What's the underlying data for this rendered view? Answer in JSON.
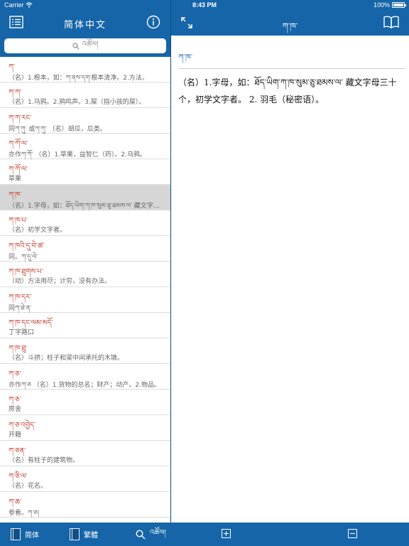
{
  "status_bar": {
    "carrier": "Carrier",
    "time": "8:43 PM",
    "battery": "100%"
  },
  "left_nav": {
    "title": "简体中文"
  },
  "right_nav": {
    "title": "ཀ་ཁ་"
  },
  "search": {
    "placeholder": "འཚོལ།"
  },
  "entries": [
    {
      "head": "ཀ་",
      "def": "（名）1.根本，如：ཀ་ནས་དག་根本清净。2.方法。"
    },
    {
      "head": "ཀ་ཀ་",
      "def": "（名）1.乌鸦。2.鸦鸣声。3.屎（指小孩的屎）。"
    },
    {
      "head": "ཀ་ཀ་རང་",
      "def": "同ཀ་ཀུ་ 或ཀ་ཀུ་ （名）胡瓜，瓜类。"
    },
    {
      "head": "ཀ་ཀོ་ལ་",
      "def": "亦作ཀ་ཀོ་ （名）1.草果，益智仁（药）。2.乌鸦。"
    },
    {
      "head": "ཀ་ཀོ་ལ་",
      "def": "草果"
    },
    {
      "head": "ཀ་ཁ་",
      "def": "（名）1.字母，如：ཐོད་ཡིག་ཀ་ཁ་སུམ་ཅུ་ཐམས་ལ་ 藏文字母三十个"
    },
    {
      "head": "ཀ་ཁ་པ་",
      "def": "（名）初学文字者。"
    },
    {
      "head": "ཀ་ཁའི་དུ་བེ་ཚ་",
      "def": "同。ཀ་དུ་ལེ་"
    },
    {
      "head": "ཀ་ཁ་ཐུགས་པ་",
      "def": "（动）方法用尽；计穷，没有办法。"
    },
    {
      "head": "ཀ་ཁ་དར་",
      "def": "同ཀ་ཐེ་ན་"
    },
    {
      "head": "ཀ་ཁ་དང་ལམ་མདོ་",
      "def": "丁字路口"
    },
    {
      "head": "ཀ་ཁ་ཐུ་",
      "def": "（名）斗拱；柱子和梁中间承托的木墩。"
    },
    {
      "head": "ཀ་ཅ་",
      "def": "亦作ཀ་ཅ （名）1.货物的总名；财产；动产。2.物品。"
    },
    {
      "head": "ཀ་ཅ་",
      "def": "房舍"
    },
    {
      "head": "ཀ་ཅ་འབྱེད་",
      "def": "开籍"
    },
    {
      "head": "ཀ་ཅན་",
      "def": "（名）有柱子的建筑物。"
    },
    {
      "head": "ཀ་ཅི་ལ་",
      "def": "（名）花名。"
    },
    {
      "head": "ཀ་ཆ་",
      "def": "参看。ཀ་ཅ།"
    }
  ],
  "selected_index": 5,
  "detail": {
    "headword": "ཀ་ཁ་",
    "body": "（名）1.字母，如：ཐོད་ཡིག་ཀ་ཁ་སུམ་ཅུ་ཐམས་ལ་ 藏文字母三十个，初学文字者。 2. 羽毛（秘密语）。"
  },
  "tabs": {
    "simplified": "简体",
    "traditional": "繁體",
    "search": "འཚོལ།"
  },
  "colors": {
    "bar": "#1565a8",
    "headword": "#c0392b",
    "detail_head": "#1f66b0",
    "selected_row": "#d6d6d6"
  },
  "icons": [
    "list-icon",
    "info-icon",
    "search-icon",
    "expand-icon",
    "book-open-icon",
    "book-icon",
    "plus-icon",
    "minus-icon",
    "wifi-icon",
    "battery-icon"
  ]
}
